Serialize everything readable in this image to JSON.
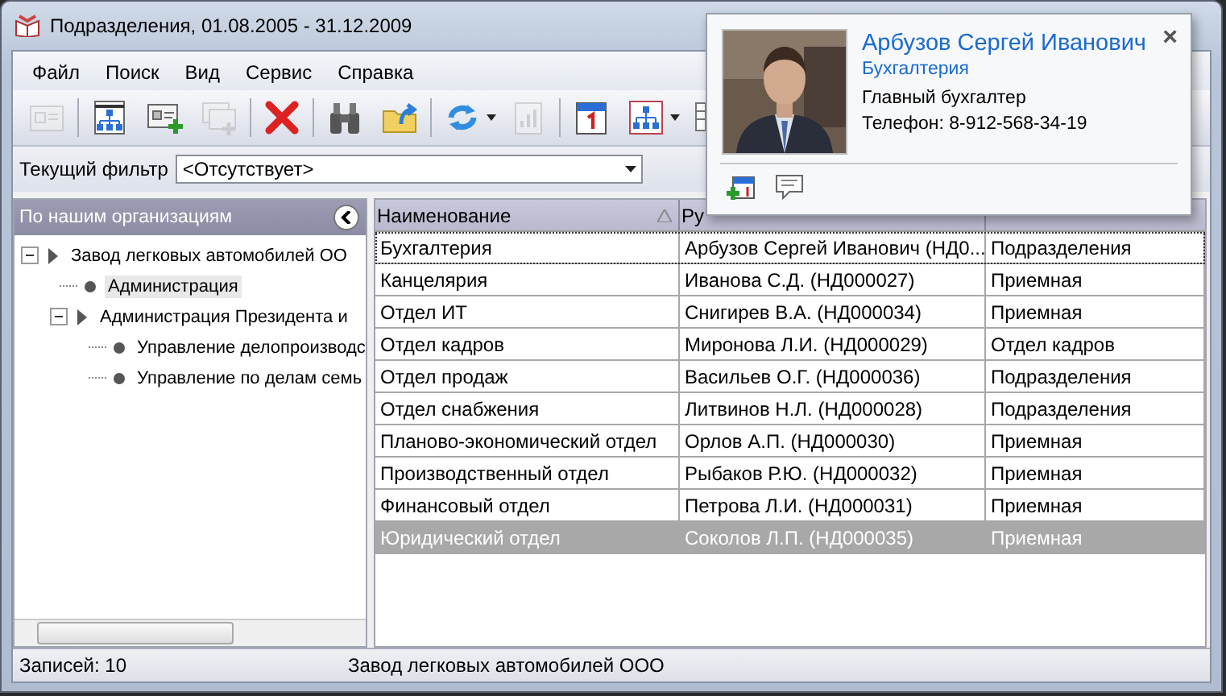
{
  "window": {
    "title": "Подразделения, 01.08.2005 - 31.12.2009"
  },
  "menu": [
    {
      "label": "Файл"
    },
    {
      "label": "Поиск"
    },
    {
      "label": "Вид"
    },
    {
      "label": "Сервис"
    },
    {
      "label": "Справка"
    }
  ],
  "toolbar": [
    {
      "kind": "card",
      "disabled": true
    },
    {
      "kind": "orgchart",
      "disabled": false
    },
    {
      "kind": "card-add",
      "disabled": false
    },
    {
      "kind": "card-copy",
      "disabled": true
    },
    {
      "kind": "delete",
      "disabled": false
    },
    {
      "kind": "binoculars",
      "disabled": false
    },
    {
      "kind": "folder-up",
      "disabled": false
    },
    {
      "kind": "refresh",
      "disabled": false
    },
    {
      "kind": "report",
      "disabled": true
    },
    {
      "kind": "calendar",
      "disabled": false
    },
    {
      "kind": "tree",
      "disabled": false
    },
    {
      "kind": "table-settings",
      "disabled": false
    }
  ],
  "filter": {
    "label": "Текущий фильтр",
    "value": "<Отсутствует>"
  },
  "sidebar": {
    "title": "По нашим организациям",
    "tree": [
      {
        "label": "Завод легковых автомобилей ОО",
        "expanded": true,
        "selected": false,
        "children": [
          {
            "label": "Администрация",
            "selected": true
          },
          {
            "label": "Администрация Президента и",
            "expanded": true,
            "selected": false,
            "children": [
              {
                "label": "Управление делопроизводс",
                "selected": false
              },
              {
                "label": "Управление по делам семь",
                "selected": false
              }
            ]
          }
        ]
      }
    ]
  },
  "table": {
    "columns": [
      {
        "label": "Наименование",
        "sorted": true
      },
      {
        "label": "Ру",
        "sorted": false
      }
    ],
    "rows": [
      {
        "cells": [
          "Бухгалтерия",
          "Арбузов Сергей Иванович (НД0...",
          "Подразделения"
        ],
        "selected": false,
        "focused": true
      },
      {
        "cells": [
          "Канцелярия",
          "Иванова С.Д. (НД000027)",
          "Приемная"
        ],
        "selected": false,
        "focused": false
      },
      {
        "cells": [
          "Отдел ИТ",
          "Снигирев В.А. (НД000034)",
          "Приемная"
        ],
        "selected": false,
        "focused": false
      },
      {
        "cells": [
          "Отдел кадров",
          "Миронова Л.И. (НД000029)",
          "Отдел кадров"
        ],
        "selected": false,
        "focused": false
      },
      {
        "cells": [
          "Отдел продаж",
          "Васильев О.Г. (НД000036)",
          "Подразделения"
        ],
        "selected": false,
        "focused": false
      },
      {
        "cells": [
          "Отдел снабжения",
          "Литвинов Н.Л. (НД000028)",
          "Подразделения"
        ],
        "selected": false,
        "focused": false
      },
      {
        "cells": [
          "Планово-экономический отдел",
          "Орлов А.П. (НД000030)",
          "Приемная"
        ],
        "selected": false,
        "focused": false
      },
      {
        "cells": [
          "Производственный отдел",
          "Рыбаков Р.Ю. (НД000032)",
          "Приемная"
        ],
        "selected": false,
        "focused": false
      },
      {
        "cells": [
          "Финансовый отдел",
          "Петрова Л.И. (НД000031)",
          "Приемная"
        ],
        "selected": false,
        "focused": false
      },
      {
        "cells": [
          "Юридический отдел",
          "Соколов Л.П. (НД000035)",
          "Приемная"
        ],
        "selected": true,
        "focused": false
      }
    ]
  },
  "status_bar": {
    "count": "Записей: 10",
    "organization": "Завод легковых автомобилей ООО"
  },
  "contact_card": {
    "name": "Арбузов Сергей Иванович",
    "department": "Бухгалтерия",
    "position": "Главный бухгалтер",
    "phone": "Телефон: 8-912-568-34-19",
    "close": "×"
  }
}
